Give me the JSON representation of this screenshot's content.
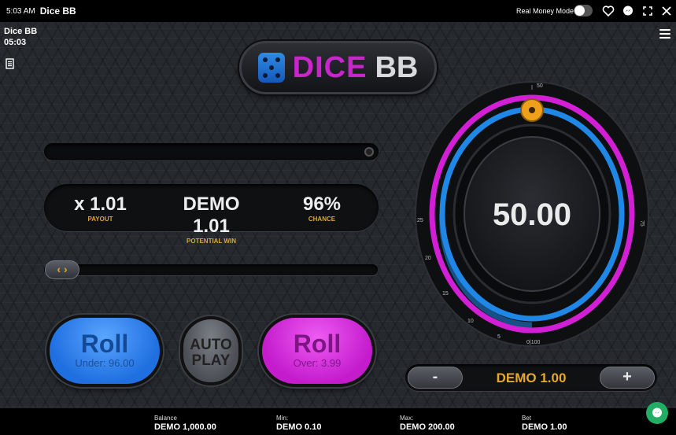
{
  "status_bar": {
    "time": "5:03 AM",
    "app_title": "Dice BB"
  },
  "top_controls": {
    "real_money_label": "Real Money Mode",
    "real_money_enabled": false
  },
  "game": {
    "name": "Dice BB",
    "clock": "05:03"
  },
  "logo": {
    "word1": "DICE",
    "word2": "BB"
  },
  "info": {
    "payout_value": "x 1.01",
    "payout_label": "PAYOUT",
    "potential_value": "DEMO 1.01",
    "potential_label": "POTENTIAL WIN",
    "chance_value": "96%",
    "chance_label": "CHANCE"
  },
  "slider": {
    "handle_glyph": "‹ ›",
    "position_fraction": 0.0
  },
  "buttons": {
    "roll_under_label": "Roll",
    "roll_under_sub": "Under: 96.00",
    "auto_line1": "AUTO",
    "auto_line2": "PLAY",
    "roll_over_label": "Roll",
    "roll_over_sub": "Over: 3.99"
  },
  "dial": {
    "value": "50.00",
    "scale_labels": [
      "50",
      "75",
      "5",
      "10",
      "15",
      "20",
      "25",
      "0|100"
    ],
    "pointer_value": 50,
    "colors": {
      "outer": "#d21fd6",
      "inner": "#1f87e6",
      "pointer": "#f0a11b"
    }
  },
  "bet": {
    "minus": "-",
    "plus": "+",
    "amount": "DEMO 1.00"
  },
  "bottom": {
    "balance_label": "Balance",
    "balance_value": "DEMO 1,000.00",
    "min_label": "Min:",
    "min_value": "DEMO 0.10",
    "max_label": "Max:",
    "max_value": "DEMO 200.00",
    "bet_label": "Bet",
    "bet_value": "DEMO 1.00"
  },
  "icons": [
    "heart-icon",
    "chat-icon",
    "fullscreen-icon",
    "close-icon",
    "document-icon",
    "hamburger-icon",
    "messenger-icon"
  ]
}
